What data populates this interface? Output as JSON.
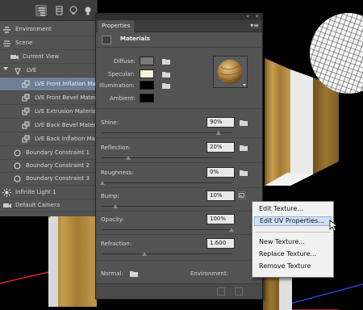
{
  "scene_panel": {
    "rows": [
      {
        "label": "Environment",
        "icon": "environment-icon",
        "selected": false
      },
      {
        "label": "Scene",
        "icon": "scene-icon",
        "selected": false
      },
      {
        "label": "Current View",
        "icon": "camera-view-icon",
        "selected": false
      },
      {
        "label": "LVE",
        "icon": "mesh-icon",
        "selected": false
      },
      {
        "label": "LVE Front Inflation Ma",
        "icon": "material-icon",
        "selected": true
      },
      {
        "label": "LVE Front Bevel Mater",
        "icon": "material-icon",
        "selected": false
      },
      {
        "label": "LVE Extrusion Materia",
        "icon": "material-icon",
        "selected": false
      },
      {
        "label": "LVE Back Bevel Materi",
        "icon": "material-icon",
        "selected": false
      },
      {
        "label": "LVE Back Inflation Ma",
        "icon": "material-icon",
        "selected": false
      },
      {
        "label": "Boundary Constraint 1",
        "icon": "constraint-icon",
        "selected": false
      },
      {
        "label": "Boundary Constraint 2",
        "icon": "constraint-icon",
        "selected": false
      },
      {
        "label": "Boundary Constraint 3",
        "icon": "constraint-icon",
        "selected": false
      },
      {
        "label": "Infinite Light 1",
        "icon": "light-icon",
        "selected": false
      },
      {
        "label": "Default Camera",
        "icon": "camera-icon",
        "selected": false
      }
    ]
  },
  "properties": {
    "tab_label": "Properties",
    "window_controls": {
      "collapse": "«",
      "close": "×"
    },
    "menu_icon": "panel-menu-icon",
    "header_title": "Materials",
    "diffuse_label": "Diffuse:",
    "specular_label": "Specular:",
    "illumination_label": "Illumination:",
    "ambient_label": "Ambient:",
    "colors": {
      "diffuse": "#7a7a7a",
      "specular": "#f9f2d8",
      "illumination": "#000000",
      "ambient": "#000000"
    },
    "shine_label": "Shine:",
    "shine_value": "90%",
    "shine_level": 0.9,
    "reflection_label": "Reflection:",
    "reflection_value": "20%",
    "reflection_level": 0.2,
    "roughness_label": "Roughness:",
    "roughness_value": "0%",
    "roughness_level": 0.0,
    "bump_label": "Bump:",
    "bump_value": "10%",
    "bump_level": 0.1,
    "opacity_label": "Opacity:",
    "opacity_value": "100%",
    "opacity_level": 1.0,
    "refraction_label": "Refraction:",
    "refraction_value": "1.600",
    "normal_label": "Normal:",
    "environment_label": "Environment:"
  },
  "context_menu": {
    "items": [
      {
        "label": "Edit Texture...",
        "highlighted": false
      },
      {
        "label": "Edit UV Properties...",
        "highlighted": true
      },
      {
        "label": "New Texture...",
        "highlighted": false
      },
      {
        "label": "Replace Texture...",
        "highlighted": false
      },
      {
        "label": "Remove Texture",
        "highlighted": false
      }
    ]
  },
  "theme": {
    "accent": "#6f7f97",
    "panel": "#535353"
  }
}
